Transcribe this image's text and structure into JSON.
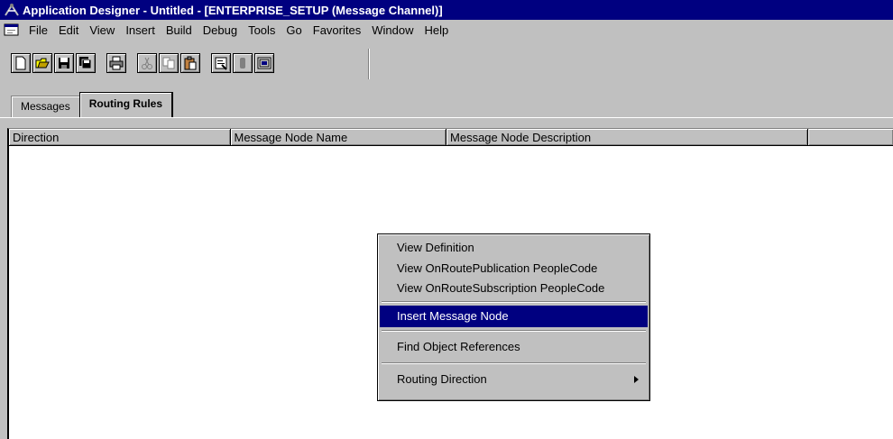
{
  "window": {
    "title": "Application Designer - Untitled - [ENTERPRISE_SETUP (Message Channel)]"
  },
  "menu": [
    {
      "label": "File",
      "name": "menu-file"
    },
    {
      "label": "Edit",
      "name": "menu-edit"
    },
    {
      "label": "View",
      "name": "menu-view"
    },
    {
      "label": "Insert",
      "name": "menu-insert"
    },
    {
      "label": "Build",
      "name": "menu-build"
    },
    {
      "label": "Debug",
      "name": "menu-debug"
    },
    {
      "label": "Tools",
      "name": "menu-tools"
    },
    {
      "label": "Go",
      "name": "menu-go"
    },
    {
      "label": "Favorites",
      "name": "menu-favorites"
    },
    {
      "label": "Window",
      "name": "menu-window"
    },
    {
      "label": "Help",
      "name": "menu-help"
    }
  ],
  "toolbar": {
    "buttons": [
      "new-icon",
      "open-icon",
      "save-icon",
      "save-all-icon",
      "print-icon",
      "cut-icon",
      "copy-icon",
      "paste-icon",
      "properties-icon",
      "upgrade-icon",
      "project-icon"
    ]
  },
  "tabs": {
    "messages": "Messages",
    "routing_rules": "Routing Rules"
  },
  "grid": {
    "columns": [
      "Direction",
      "Message Node Name",
      "Message Node Description",
      ""
    ]
  },
  "context_menu": {
    "view_definition": "View Definition",
    "view_onroute_publication": "View OnRoutePublication PeopleCode",
    "view_onroute_subscription": "View OnRouteSubscription PeopleCode",
    "insert_message_node": "Insert Message Node",
    "find_object_references": "Find Object References",
    "routing_direction": "Routing Direction"
  }
}
